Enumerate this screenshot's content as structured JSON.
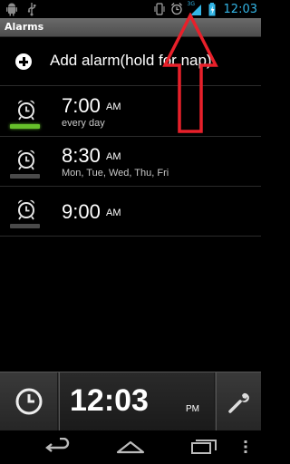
{
  "status_bar": {
    "time": "12:03",
    "network_label": "3G",
    "left_icons": [
      "android-icon",
      "usb-icon"
    ],
    "right_icons": [
      "vibrate-icon",
      "alarm-icon",
      "signal-icon",
      "battery-icon"
    ]
  },
  "title_bar": {
    "title": "Alarms"
  },
  "add_alarm": {
    "label": "Add alarm(hold for nap)",
    "icon": "plus-icon"
  },
  "alarms": [
    {
      "time": "7:00",
      "ampm": "AM",
      "days": "every day",
      "enabled": true
    },
    {
      "time": "8:30",
      "ampm": "AM",
      "days": "Mon, Tue, Wed, Thu, Fri",
      "enabled": false
    },
    {
      "time": "9:00",
      "ampm": "AM",
      "days": "",
      "enabled": false
    }
  ],
  "bottom_bar": {
    "clock": "12:03",
    "ampm": "PM",
    "left_icon": "clock-icon",
    "right_icon": "wrench-icon"
  },
  "navigation": {
    "buttons": [
      "back-icon",
      "home-icon",
      "recent-apps-icon",
      "menu-icon"
    ]
  },
  "colors": {
    "accent": "#33b5e5",
    "enabled_bar": "#66c02b",
    "disabled_bar": "#4a4a4a",
    "annotation_arrow": "#e8202a"
  }
}
